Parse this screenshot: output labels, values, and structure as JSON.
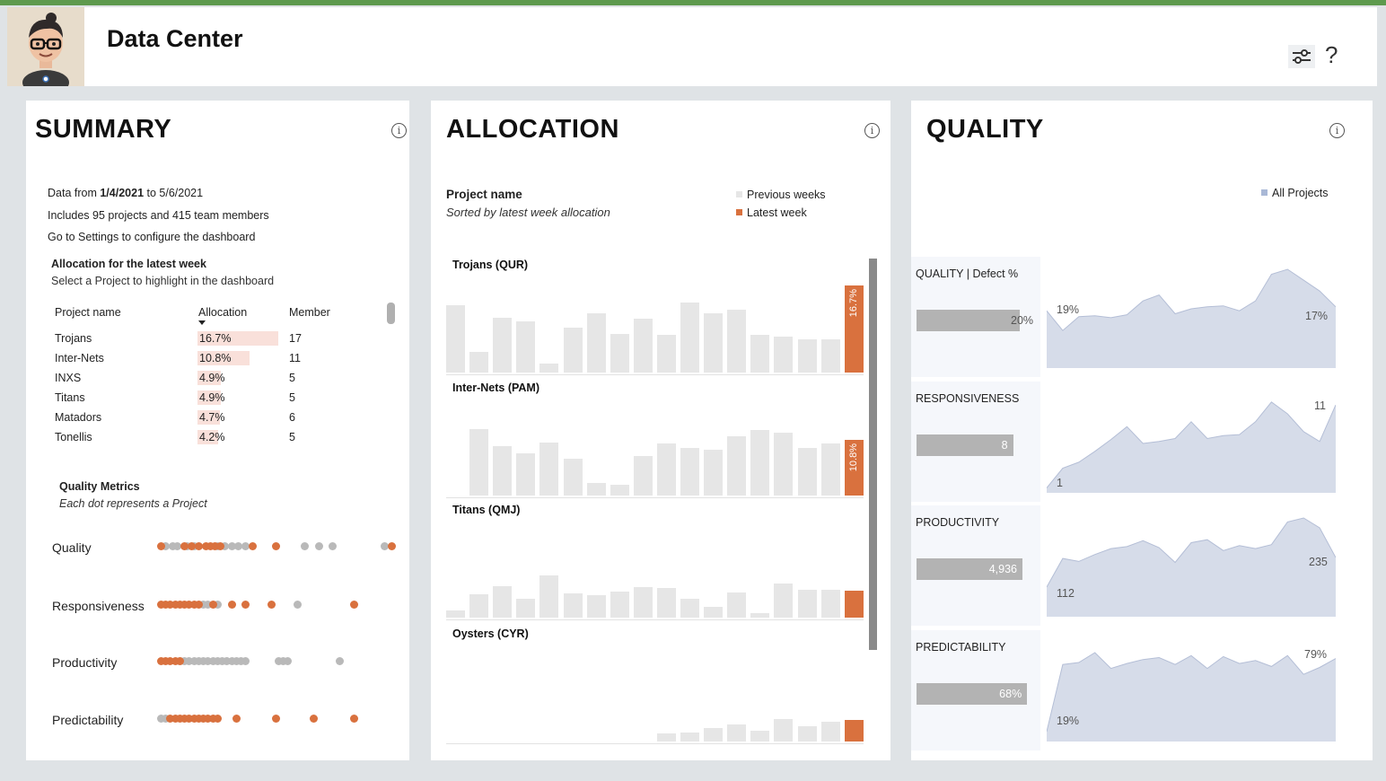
{
  "header": {
    "title": "Data Center"
  },
  "summary": {
    "title": "SUMMARY",
    "lines": {
      "range_prefix": "Data from ",
      "range_start": "1/4/2021",
      "range_mid": " to ",
      "range_end": "5/6/2021",
      "includes": "Includes 95 projects and 415 team members",
      "settings": "Go to Settings to configure the dashboard"
    },
    "alloc_heading": "Allocation for the latest week",
    "alloc_sub": "Select a Project to highlight in the dashboard",
    "columns": {
      "project": "Project name",
      "allocation": "Allocation",
      "member": "Member"
    },
    "rows": [
      {
        "name": "Trojans",
        "allocation": "16.7%",
        "alloc_value": 16.7,
        "member": "17"
      },
      {
        "name": "Inter-Nets",
        "allocation": "10.8%",
        "alloc_value": 10.8,
        "member": "11"
      },
      {
        "name": "INXS",
        "allocation": "4.9%",
        "alloc_value": 4.9,
        "member": "5"
      },
      {
        "name": "Titans",
        "allocation": "4.9%",
        "alloc_value": 4.9,
        "member": "5"
      },
      {
        "name": "Matadors",
        "allocation": "4.7%",
        "alloc_value": 4.7,
        "member": "6"
      },
      {
        "name": "Tonellis",
        "allocation": "4.2%",
        "alloc_value": 4.2,
        "member": "5"
      }
    ],
    "quality_metrics_heading": "Quality Metrics",
    "quality_metrics_sub": "Each dot represents a Project",
    "dot_metrics": [
      {
        "label": "Quality",
        "grey": [
          0.02,
          0.05,
          0.07,
          0.11,
          0.14,
          0.24,
          0.27,
          0.3,
          0.33,
          0.36,
          0.61,
          0.67,
          0.73,
          0.95
        ],
        "orange": [
          0.0,
          0.1,
          0.13,
          0.16,
          0.19,
          0.21,
          0.23,
          0.25,
          0.39,
          0.49,
          0.98
        ]
      },
      {
        "label": "Responsiveness",
        "grey": [
          0.18,
          0.2,
          0.24,
          0.58
        ],
        "orange": [
          0.0,
          0.02,
          0.04,
          0.06,
          0.08,
          0.1,
          0.12,
          0.14,
          0.16,
          0.22,
          0.3,
          0.36,
          0.47,
          0.82
        ]
      },
      {
        "label": "Productivity",
        "grey": [
          0.08,
          0.1,
          0.12,
          0.14,
          0.16,
          0.18,
          0.2,
          0.22,
          0.24,
          0.26,
          0.28,
          0.3,
          0.32,
          0.34,
          0.36,
          0.5,
          0.52,
          0.54,
          0.76
        ],
        "orange": [
          0.0,
          0.02,
          0.04,
          0.06,
          0.08
        ]
      },
      {
        "label": "Predictability",
        "grey": [
          0.0,
          0.02
        ],
        "orange": [
          0.04,
          0.06,
          0.08,
          0.1,
          0.12,
          0.14,
          0.16,
          0.18,
          0.2,
          0.22,
          0.24,
          0.32,
          0.49,
          0.65,
          0.82
        ]
      }
    ],
    "colors": {
      "orange": "#d9713e",
      "grey": "#b9b9b9",
      "highlight": "#f9e0da"
    }
  },
  "allocation": {
    "title": "ALLOCATION",
    "project_name_heading": "Project name",
    "sorted_note": "Sorted by latest week allocation",
    "legend": {
      "previous": "Previous weeks",
      "latest": "Latest week"
    },
    "colors": {
      "previous": "#e6e6e6",
      "latest": "#d9713e"
    },
    "projects": [
      {
        "label": "Trojans (QUR)",
        "latest_label": "16.7%",
        "weeks": [
          0.72,
          0.22,
          0.59,
          0.55,
          0.1,
          0.48,
          0.63,
          0.41,
          0.58,
          0.4,
          0.75,
          0.63,
          0.67,
          0.4,
          0.38,
          0.36,
          0.36,
          0.93
        ]
      },
      {
        "label": "Inter-Nets (PAM)",
        "latest_label": "10.8%",
        "weeks": [
          0.71,
          0.53,
          0.45,
          0.57,
          0.39,
          0.13,
          0.12,
          0.42,
          0.56,
          0.51,
          0.49,
          0.63,
          0.7,
          0.67,
          0.51,
          0.56,
          0.6
        ]
      },
      {
        "label": "Titans (QMJ)",
        "latest_label": "",
        "weeks": [
          0.08,
          0.25,
          0.34,
          0.2,
          0.45,
          0.26,
          0.24,
          0.28,
          0.33,
          0.32,
          0.2,
          0.12,
          0.27,
          0.05,
          0.37,
          0.3,
          0.3,
          0.29
        ]
      },
      {
        "label": "Oysters (CYR)",
        "latest_label": "",
        "weeks": [
          0,
          0,
          0,
          0,
          0,
          0,
          0,
          0,
          0.09,
          0.1,
          0.14,
          0.18,
          0.12,
          0.24,
          0.16,
          0.21,
          0.23
        ]
      }
    ]
  },
  "quality": {
    "title": "QUALITY",
    "legend": "All Projects",
    "area_color": "#d6dce9",
    "area_stroke": "#b4bed6",
    "metrics": [
      {
        "title": "QUALITY | Defect %",
        "bar_label": "20%",
        "bar_fraction": 0.66,
        "start_label": "19%",
        "end_label": "17%",
        "series": [
          0.58,
          0.38,
          0.52,
          0.53,
          0.51,
          0.54,
          0.68,
          0.74,
          0.55,
          0.6,
          0.62,
          0.63,
          0.58,
          0.68,
          0.95,
          1.0,
          0.89,
          0.78,
          0.62
        ]
      },
      {
        "title": "RESPONSIVENESS",
        "bar_label": "8",
        "bar_fraction": 0.62,
        "start_label": "1",
        "end_label": "11",
        "series": [
          0.05,
          0.25,
          0.31,
          0.42,
          0.54,
          0.67,
          0.5,
          0.52,
          0.55,
          0.72,
          0.55,
          0.58,
          0.59,
          0.72,
          0.92,
          0.8,
          0.62,
          0.52,
          0.89
        ]
      },
      {
        "title": "PRODUCTIVITY",
        "bar_label": "4,936",
        "bar_fraction": 0.68,
        "start_label": "112",
        "end_label": "235",
        "series": [
          0.3,
          0.59,
          0.56,
          0.63,
          0.69,
          0.71,
          0.77,
          0.7,
          0.55,
          0.75,
          0.78,
          0.67,
          0.72,
          0.69,
          0.73,
          0.96,
          1.0,
          0.9,
          0.6
        ]
      },
      {
        "title": "PREDICTABILITY",
        "bar_label": "68%",
        "bar_fraction": 0.71,
        "start_label": "19%",
        "end_label": "79%",
        "series": [
          0.1,
          0.78,
          0.8,
          0.9,
          0.74,
          0.79,
          0.83,
          0.85,
          0.78,
          0.87,
          0.74,
          0.86,
          0.79,
          0.82,
          0.76,
          0.87,
          0.68,
          0.75,
          0.84
        ]
      }
    ]
  }
}
